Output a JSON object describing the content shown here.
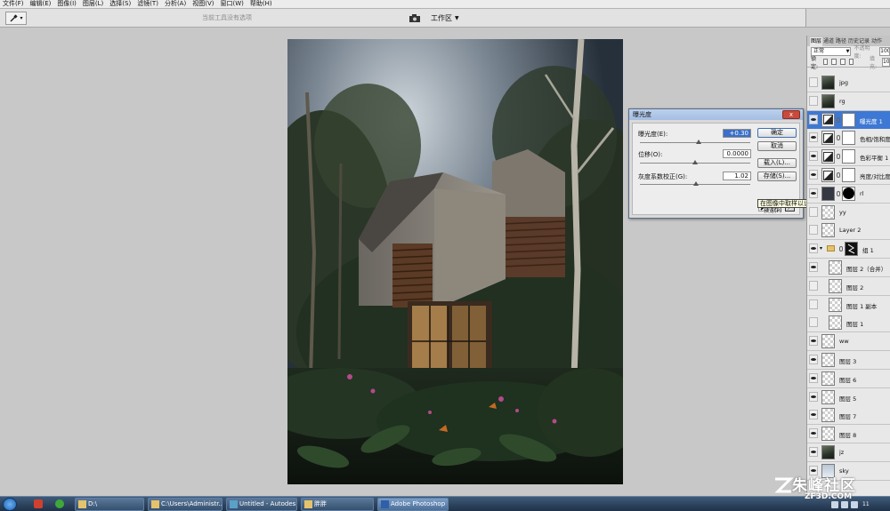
{
  "menubar": {
    "items": [
      "文件(F)",
      "编辑(E)",
      "图像(I)",
      "图层(L)",
      "选择(S)",
      "滤镜(T)",
      "分析(A)",
      "视图(V)",
      "窗口(W)",
      "帮助(H)"
    ]
  },
  "options_bar": {
    "hint": "当前工具没有选项",
    "workspace_label": "工作区"
  },
  "exposure_dialog": {
    "title": "曝光度",
    "close_label": "x",
    "exposure_label": "曝光度(E):",
    "exposure_value": "+0.30",
    "exposure_level": 0.53,
    "offset_label": "位移(O):",
    "offset_value": "0.0000",
    "offset_level": 0.5,
    "gamma_label": "灰度系数校正(G):",
    "gamma_value": "1.02",
    "gamma_level": 0.51,
    "ok_label": "确定",
    "cancel_label": "取消",
    "load_label": "载入(L)...",
    "save_label": "存储(S)...",
    "preview_label": "预览(P)",
    "tooltip": "在图像中取样以设置黑场"
  },
  "layers_panel": {
    "tabs": [
      "图层",
      "通道",
      "路径",
      "历史记录",
      "动作"
    ],
    "blend_mode": "正常",
    "opacity_label": "不透明度:",
    "opacity_value": "100",
    "lock_label": "锁定:",
    "fill_label": "填充:",
    "fill_value": "100",
    "layers": [
      {
        "name": "jpg",
        "visible": false,
        "thumb": "photo"
      },
      {
        "name": "rg",
        "visible": false,
        "thumb": "photo"
      },
      {
        "name": "曝光度 1",
        "visible": true,
        "thumb": "adj",
        "mask": "mask",
        "selected": true
      },
      {
        "name": "色相/饱和度",
        "visible": true,
        "thumb": "adj",
        "mask": "mask"
      },
      {
        "name": "色彩平衡 1",
        "visible": true,
        "thumb": "adj",
        "mask": "mask"
      },
      {
        "name": "亮度/对比度",
        "visible": true,
        "thumb": "adj",
        "mask": "mask"
      },
      {
        "name": "rl",
        "visible": true,
        "thumb": "dark",
        "mask": "mask-circle"
      },
      {
        "name": "yy",
        "visible": false,
        "thumb": "transparent"
      },
      {
        "name": "Layer 2",
        "visible": false,
        "thumb": "transparent"
      },
      {
        "name": "组 1",
        "visible": true,
        "group": true,
        "mask": "scribble"
      },
      {
        "name": "图层 2（合并）",
        "visible": true,
        "thumb": "transparent",
        "indent": true
      },
      {
        "name": "图层 2",
        "visible": false,
        "thumb": "transparent",
        "indent": true
      },
      {
        "name": "图层 1 副本",
        "visible": false,
        "thumb": "transparent",
        "indent": true
      },
      {
        "name": "图层 1",
        "visible": false,
        "thumb": "transparent",
        "indent": true
      },
      {
        "name": "ww",
        "visible": true,
        "thumb": "transparent"
      },
      {
        "name": "图层 3",
        "visible": true,
        "thumb": "transparent"
      },
      {
        "name": "图层 6",
        "visible": true,
        "thumb": "transparent"
      },
      {
        "name": "图层 5",
        "visible": true,
        "thumb": "transparent"
      },
      {
        "name": "图层 7",
        "visible": true,
        "thumb": "transparent"
      },
      {
        "name": "图层 8",
        "visible": true,
        "thumb": "transparent"
      },
      {
        "name": "jz",
        "visible": true,
        "thumb": "photo"
      },
      {
        "name": "sky",
        "visible": true,
        "thumb": "sky"
      }
    ]
  },
  "taskbar": {
    "items": [
      {
        "label": "D:\\",
        "icon": "folder-icon"
      },
      {
        "label": "C:\\Users\\Administr...",
        "icon": "folder-icon"
      },
      {
        "label": "Untitled - Autodes...",
        "icon": "3dsmax-icon"
      },
      {
        "label": "胖胖",
        "icon": "folder-icon"
      },
      {
        "label": "Adobe Photoshop ...",
        "icon": "photoshop-icon",
        "active": true
      }
    ],
    "clock": "11"
  },
  "watermark": {
    "text": "朱峰社区",
    "sub": "ZF3D.COM"
  },
  "colors": {
    "selection": "#3d78d4",
    "dialog_title": "#a4bde2",
    "taskbar": "#1f3249"
  }
}
